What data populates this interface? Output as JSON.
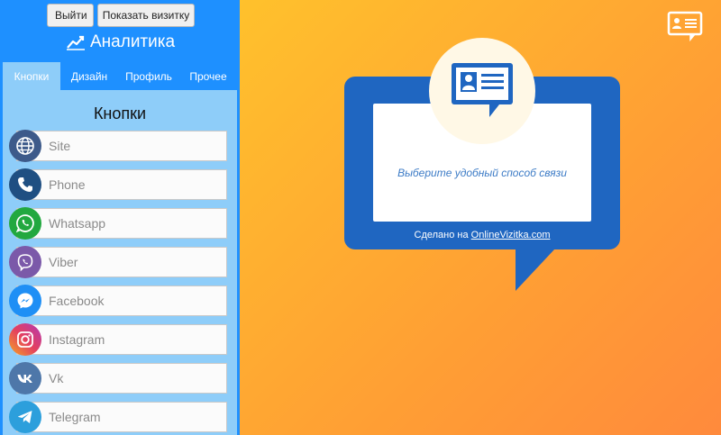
{
  "header": {
    "exit_label": "Выйти",
    "show_card_label": "Показать визитку",
    "analytics_label": "Аналитика"
  },
  "tabs": [
    {
      "label": "Кнопки",
      "active": true
    },
    {
      "label": "Дизайн",
      "active": false
    },
    {
      "label": "Профиль",
      "active": false
    },
    {
      "label": "Прочее",
      "active": false
    }
  ],
  "buttons_section": {
    "title": "Кнопки",
    "items": [
      {
        "label": "Site",
        "icon": "globe-icon",
        "color": "#3d5a8a"
      },
      {
        "label": "Phone",
        "icon": "phone-icon",
        "color": "#1f4f82"
      },
      {
        "label": "Whatsapp",
        "icon": "whatsapp-icon",
        "color": "#22a83f"
      },
      {
        "label": "Viber",
        "icon": "viber-icon",
        "color": "#7b59a9"
      },
      {
        "label": "Facebook",
        "icon": "messenger-icon",
        "color": "#1f8ff5"
      },
      {
        "label": "Instagram",
        "icon": "instagram-icon",
        "color": "#d6307a"
      },
      {
        "label": "Vk",
        "icon": "vk-icon",
        "color": "#4e77a9"
      },
      {
        "label": "Telegram",
        "icon": "telegram-icon",
        "color": "#2c9fdc"
      }
    ]
  },
  "preview": {
    "prompt": "Выберите удобный способ связи",
    "made_by_prefix": "Сделано на ",
    "made_by_link": "OnlineVizitka.com"
  },
  "colors": {
    "panel_blue": "#1e90ff",
    "content_light_blue": "#8ecdf9",
    "card_blue": "#1f66c1",
    "bg_orange": "#ffb02e"
  }
}
